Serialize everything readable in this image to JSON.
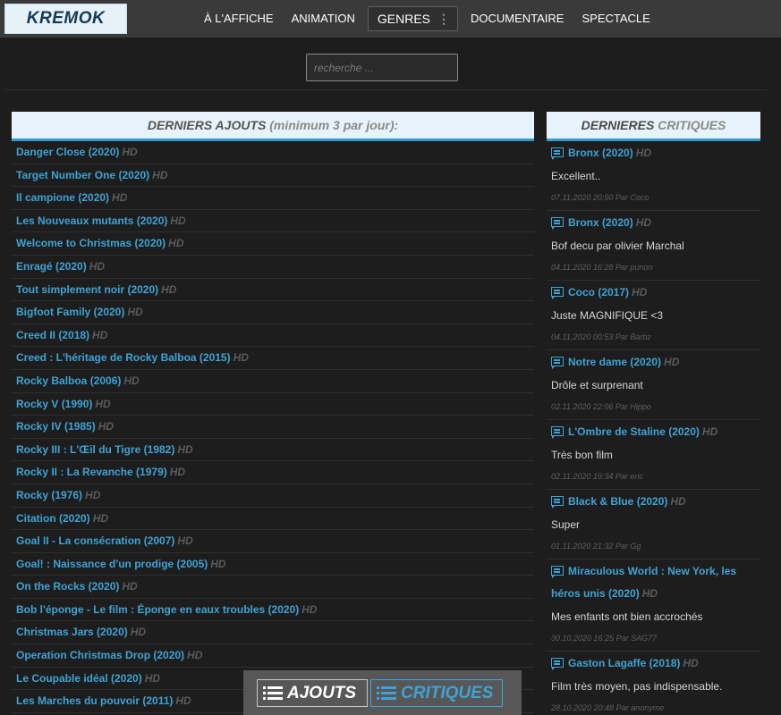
{
  "logo": "KREMOK",
  "nav": [
    "À L'AFFICHE",
    "ANIMATION",
    "GENRES",
    "DOCUMENTAIRE",
    "SPECTACLE"
  ],
  "search": {
    "placeholder": "recherche ..."
  },
  "ajouts": {
    "heading": "DERNIERS AJOUTS",
    "heading_note": "(minimum 3 par jour):",
    "items": [
      {
        "title": "Danger Close (2020)",
        "badge": "HD"
      },
      {
        "title": "Target Number One (2020)",
        "badge": "HD"
      },
      {
        "title": "Il campione (2020)",
        "badge": "HD"
      },
      {
        "title": "Les Nouveaux mutants (2020)",
        "badge": "HD"
      },
      {
        "title": "Welcome to Christmas (2020)",
        "badge": "HD"
      },
      {
        "title": "Enragé (2020)",
        "badge": "HD"
      },
      {
        "title": "Tout simplement noir (2020)",
        "badge": "HD"
      },
      {
        "title": "Bigfoot Family (2020)",
        "badge": "HD"
      },
      {
        "title": "Creed II (2018)",
        "badge": "HD"
      },
      {
        "title": "Creed : L'héritage de Rocky Balboa (2015)",
        "badge": "HD"
      },
      {
        "title": "Rocky Balboa (2006)",
        "badge": "HD"
      },
      {
        "title": "Rocky V (1990)",
        "badge": "HD"
      },
      {
        "title": "Rocky IV (1985)",
        "badge": "HD"
      },
      {
        "title": "Rocky III : L'Œil du Tigre (1982)",
        "badge": "HD"
      },
      {
        "title": "Rocky II : La Revanche (1979)",
        "badge": "HD"
      },
      {
        "title": "Rocky (1976)",
        "badge": "HD"
      },
      {
        "title": "Citation (2020)",
        "badge": "HD"
      },
      {
        "title": "Goal II - La consécration (2007)",
        "badge": "HD"
      },
      {
        "title": "Goal! : Naissance d'un prodige (2005)",
        "badge": "HD"
      },
      {
        "title": "On the Rocks (2020)",
        "badge": "HD"
      },
      {
        "title": "Bob l'éponge - Le film : Éponge en eaux troubles (2020)",
        "badge": "HD"
      },
      {
        "title": "Christmas Jars (2020)",
        "badge": "HD"
      },
      {
        "title": "Operation Christmas Drop (2020)",
        "badge": "HD"
      },
      {
        "title": "Le Coupable idéal (2020)",
        "badge": "HD"
      },
      {
        "title": "Les Marches du pouvoir (2011)",
        "badge": "HD"
      }
    ]
  },
  "critiques": {
    "heading_a": "DERNIERES",
    "heading_b": "CRITIQUES",
    "items": [
      {
        "title": "Bronx (2020)",
        "badge": "HD",
        "text": "Excellent..",
        "meta": "07.11.2020 20:50 Par Coco"
      },
      {
        "title": "Bronx (2020)",
        "badge": "HD",
        "text": "Bof decu par olivier Marchal",
        "meta": "04.11.2020 16:28 Par punon"
      },
      {
        "title": "Coco (2017)",
        "badge": "HD",
        "text": "Juste MAGNIFIQUE <3",
        "meta": "04.11.2020 00:53 Par Barbz"
      },
      {
        "title": "Notre dame (2020)",
        "badge": "HD",
        "text": "Drôle et surprenant",
        "meta": "02.11.2020 22:06 Par Hippo"
      },
      {
        "title": "L'Ombre de Staline (2020)",
        "badge": "HD",
        "text": "Très bon film",
        "meta": "02.11.2020 19:34 Par eric"
      },
      {
        "title": "Black & Blue (2020)",
        "badge": "HD",
        "text": "Super",
        "meta": "01.11.2020 21:32 Par Gg"
      },
      {
        "title": "Miraculous World : New York, les héros unis (2020)",
        "badge": "HD",
        "text": "Mes enfants ont bien accrochés",
        "meta": "30.10.2020 16:25 Par SAG77"
      },
      {
        "title": "Gaston Lagaffe (2018)",
        "badge": "HD",
        "text": "Film très moyen, pas indispensable.",
        "meta": "28.10.2020 20:48 Par anonyme"
      }
    ]
  },
  "floatbar": {
    "ajouts": "AJOUTS",
    "critiques": "CRITIQUES"
  }
}
